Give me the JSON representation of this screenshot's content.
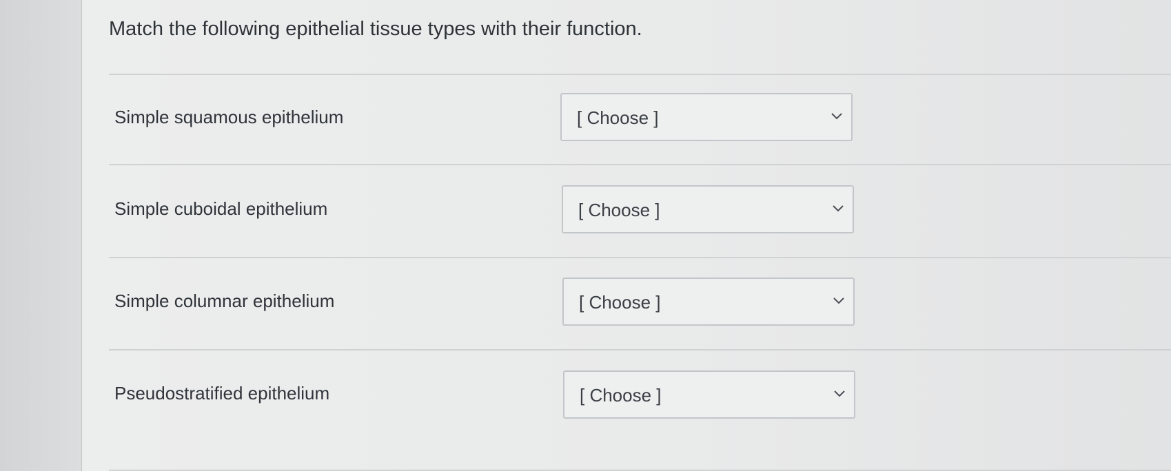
{
  "question": {
    "prompt": "Match the following epithelial tissue types with their function."
  },
  "rows": [
    {
      "term": "Simple squamous epithelium",
      "selected": "[ Choose ]",
      "icon": "chevron-down-icon"
    },
    {
      "term": "Simple cuboidal epithelium",
      "selected": "[ Choose ]",
      "icon": "chevron-down-icon"
    },
    {
      "term": "Simple columnar epithelium",
      "selected": "[ Choose ]",
      "icon": "chevron-down-icon"
    },
    {
      "term": "Pseudostratified epithelium",
      "selected": "[ Choose ]",
      "icon": "chevron-down-icon"
    }
  ],
  "colors": {
    "background": "#eceded",
    "text": "#2e3338",
    "border": "#c3c6c9"
  }
}
